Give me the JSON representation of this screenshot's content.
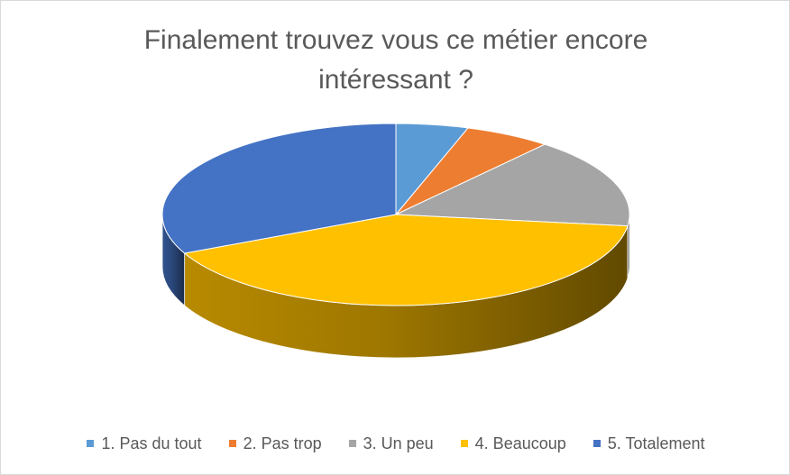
{
  "chart_data": {
    "type": "pie",
    "title": "Finalement trouvez vous ce métier encore intéressant ?",
    "categories": [
      "1. Pas du tout",
      "2. Pas trop",
      "3. Un peu",
      "4. Beaucoup",
      "5. Totalement"
    ],
    "values": [
      5,
      6,
      16,
      41,
      32
    ],
    "colors": [
      "#5B9BD5",
      "#ED7D31",
      "#A5A5A5",
      "#FFC000",
      "#4472C4"
    ],
    "legend_position": "bottom",
    "style": "3d"
  }
}
